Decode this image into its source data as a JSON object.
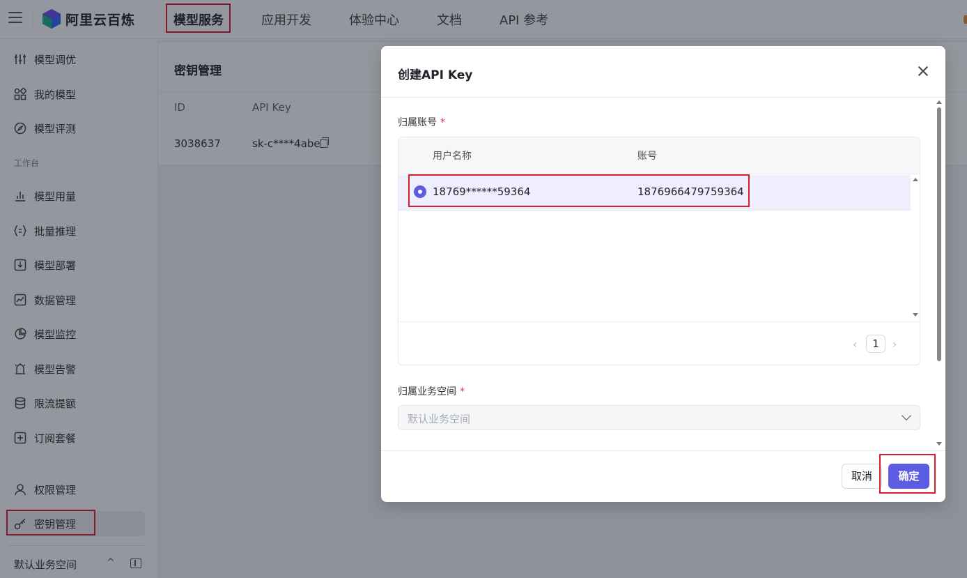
{
  "header": {
    "brand": "阿里云百炼",
    "nav": [
      "模型服务",
      "应用开发",
      "体验中心",
      "文档",
      "API 参考"
    ],
    "active_nav": "模型服务"
  },
  "sidebar": {
    "items_top": [
      {
        "label": "模型调优",
        "icon": "sliders-icon"
      },
      {
        "label": "我的模型",
        "icon": "apps-icon"
      },
      {
        "label": "模型评测",
        "icon": "compass-icon"
      }
    ],
    "section_label": "工作台",
    "items_workbench": [
      {
        "label": "模型用量",
        "icon": "bar-chart-icon"
      },
      {
        "label": "批量推理",
        "icon": "braces-icon"
      },
      {
        "label": "模型部署",
        "icon": "deploy-icon"
      },
      {
        "label": "数据管理",
        "icon": "trend-icon"
      },
      {
        "label": "模型监控",
        "icon": "pie-icon"
      },
      {
        "label": "模型告警",
        "icon": "alarm-icon"
      },
      {
        "label": "限流提额",
        "icon": "database-icon"
      },
      {
        "label": "订阅套餐",
        "icon": "plus-square-icon"
      }
    ],
    "items_bottom": [
      {
        "label": "权限管理",
        "icon": "user-icon"
      },
      {
        "label": "密钥管理",
        "icon": "key-icon"
      }
    ],
    "active_item": "密钥管理",
    "workspace": "默认业务空间"
  },
  "page": {
    "title": "密钥管理",
    "table": {
      "headers": [
        "ID",
        "API Key"
      ],
      "rows": [
        {
          "id": "3038637",
          "api_key": "sk-c****4abe"
        }
      ]
    }
  },
  "modal": {
    "title": "创建API Key",
    "account_label": "归属账号",
    "required_mark": "*",
    "account_table": {
      "headers": [
        "用户名称",
        "账号"
      ],
      "rows": [
        {
          "username": "18769******59364",
          "account": "1876966479759364",
          "selected": true
        }
      ],
      "pagination": {
        "prev": "‹",
        "page": "1",
        "next": "›"
      }
    },
    "workspace_label": "归属业务空间",
    "workspace_value": "默认业务空间",
    "cancel_label": "取消",
    "ok_label": "确定"
  },
  "colors": {
    "accent": "#5b5ce2",
    "highlight_box": "#d9202a",
    "selected_row": "#eeeefc"
  }
}
